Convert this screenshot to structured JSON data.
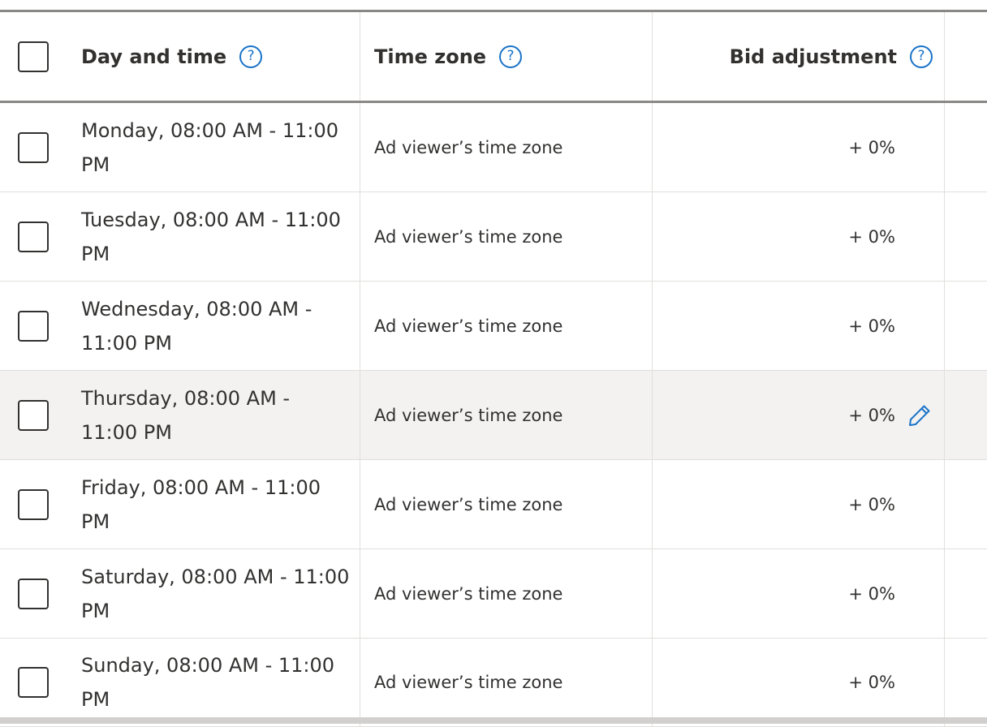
{
  "table": {
    "columns": {
      "day_and_time": "Day and time",
      "time_zone": "Time zone",
      "bid_adjustment": "Bid adjustment"
    },
    "help_glyph": "?",
    "icons": {
      "help": "question-circle-icon",
      "edit": "pencil-icon"
    },
    "accent_color": "#1a73c8",
    "hover_row_color": "#f3f2f1",
    "rows": [
      {
        "day_time": "Monday, 08:00 AM - 11:00 PM",
        "time_zone": "Ad viewer’s time zone",
        "bid": "+ 0%"
      },
      {
        "day_time": "Tuesday, 08:00 AM - 11:00 PM",
        "time_zone": "Ad viewer’s time zone",
        "bid": "+ 0%"
      },
      {
        "day_time": "Wednesday, 08:00 AM - 11:00 PM",
        "time_zone": "Ad viewer’s time zone",
        "bid": "+ 0%"
      },
      {
        "day_time": "Thursday, 08:00 AM - 11:00 PM",
        "time_zone": "Ad viewer’s time zone",
        "bid": "+ 0%"
      },
      {
        "day_time": "Friday, 08:00 AM - 11:00 PM",
        "time_zone": "Ad viewer’s time zone",
        "bid": "+ 0%"
      },
      {
        "day_time": "Saturday, 08:00 AM - 11:00 PM",
        "time_zone": "Ad viewer’s time zone",
        "bid": "+ 0%"
      },
      {
        "day_time": "Sunday, 08:00 AM - 11:00 PM",
        "time_zone": "Ad viewer’s time zone",
        "bid": "+ 0%"
      }
    ]
  }
}
